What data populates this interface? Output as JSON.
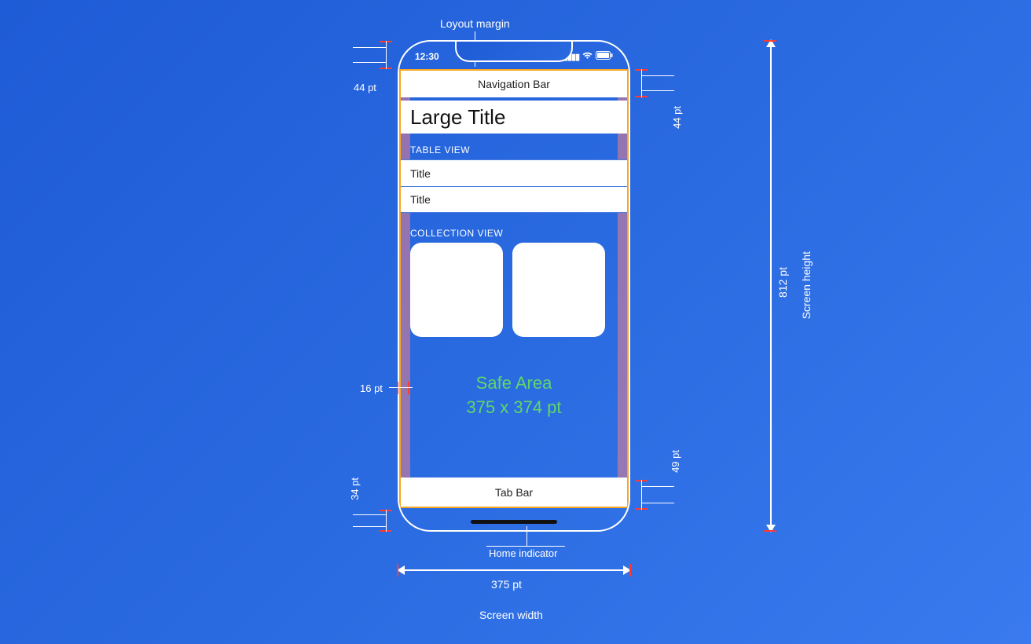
{
  "labels": {
    "layout_margin": "Loyout margin",
    "screen_height": "Screen height",
    "screen_width": "Screen width",
    "home_indicator": "Home indicator",
    "width_value": "375 pt",
    "height_value": "812 pt",
    "nav_bar_height": "44 pt",
    "status_to_nav": "44 pt",
    "tab_bar_height": "49 pt",
    "home_indicator_height": "34 pt",
    "margin_width": "16 pt"
  },
  "phone": {
    "status_time": "12:30",
    "nav_bar": "Navigation Bar",
    "large_title": "Large Title",
    "table_header": "TABLE VIEW",
    "row1": "Title",
    "row2": "Title",
    "collection_header": "COLLECTION VIEW",
    "tab_bar": "Tab Bar",
    "safe_area_line1": "Safe Area",
    "safe_area_line2": "375 x 374 pt"
  }
}
